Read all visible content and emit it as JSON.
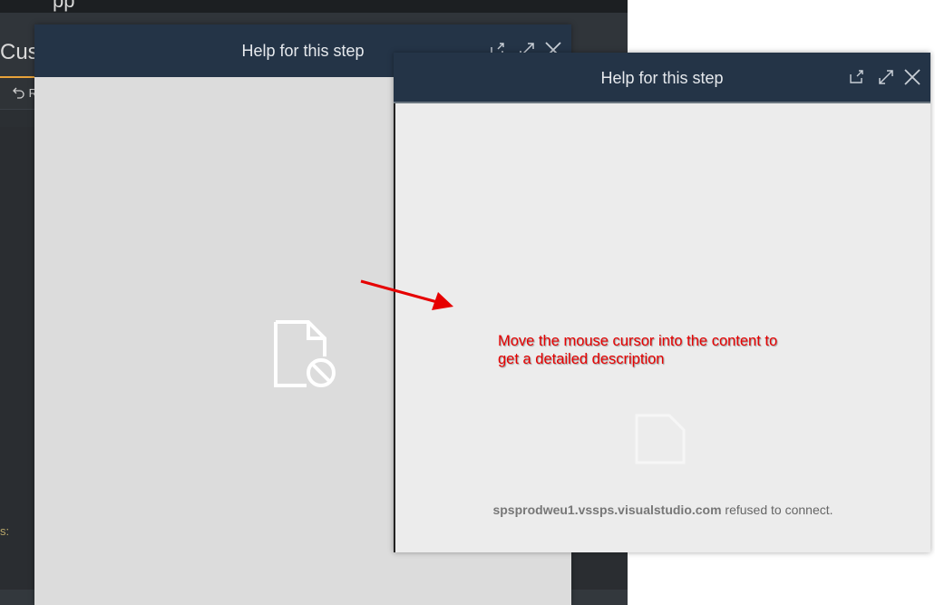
{
  "background_app": {
    "top_text": "pp",
    "title": "Cus",
    "undo_label": "R",
    "field_label": "s:"
  },
  "dialog_back": {
    "title": "Help for this step",
    "body_icon": "blocked-document-icon"
  },
  "dialog_front": {
    "title": "Help for this step",
    "body_icon": "blocked-document-icon",
    "refused_host": "spsprodweu1.vssps.visualstudio.com",
    "refused_suffix": " refused to connect."
  },
  "annotation": {
    "text_line1": "Move the mouse cursor into the content to",
    "text_line2": "get a detailed description",
    "color": "#e60000"
  },
  "icons": [
    "popout-icon",
    "expand-icon",
    "close-icon",
    "undo-icon"
  ]
}
